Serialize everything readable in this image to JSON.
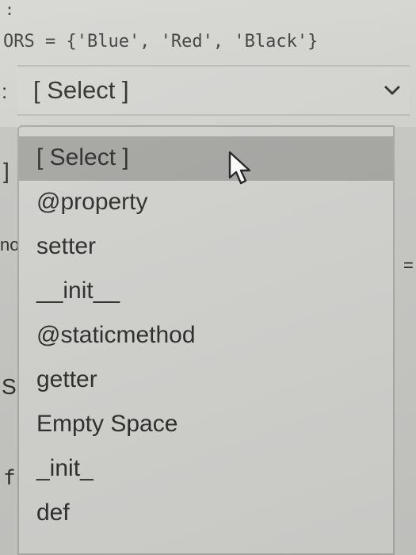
{
  "code": {
    "top_fragment": ":",
    "colors_line": "ORS = {'Blue', 'Red', 'Black'}"
  },
  "select": {
    "current_value": "[ Select ]",
    "chevron_icon": "chevron-down-icon"
  },
  "dropdown": {
    "options": [
      "[ Select ]",
      "@property",
      "setter",
      "__init__",
      "@staticmethod",
      "getter",
      "Empty Space",
      "_init_",
      "def"
    ],
    "highlighted_index": 0
  },
  "left_snippets": {
    "s1": ":",
    "s2": "]",
    "s3": "no",
    "s4": "S",
    "s5": "f"
  },
  "right_snippets": {
    "r1": "="
  },
  "cursor_icon": "mouse-pointer-icon"
}
